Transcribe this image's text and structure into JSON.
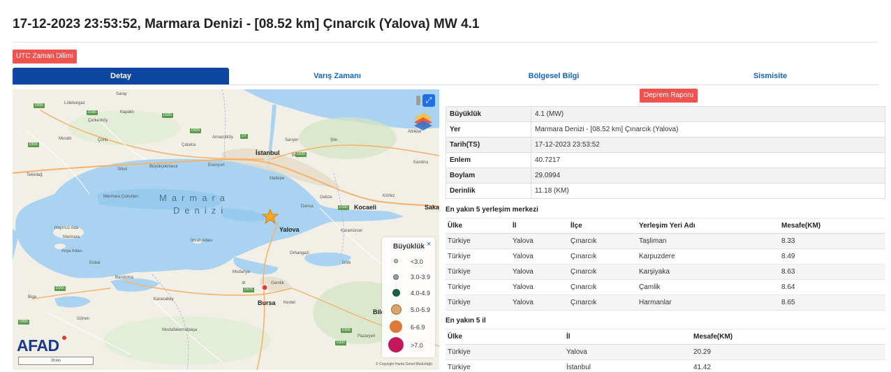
{
  "title": "17-12-2023 23:53:52, Marmara Denizi - [08.52 km] Çınarcık (Yalova) MW 4.1",
  "utc_button": "UTC Zaman Dilimi",
  "tabs": [
    {
      "label": "Detay",
      "active": true
    },
    {
      "label": "Varış Zamanı",
      "active": false
    },
    {
      "label": "Bölgesel Bilgi",
      "active": false
    },
    {
      "label": "Sismisite",
      "active": false
    }
  ],
  "report_button": "Deprem Raporu",
  "details": [
    {
      "key": "Büyüklük",
      "value": "4.1 (MW)"
    },
    {
      "key": "Yer",
      "value": "Marmara Denizi - [08.52 km] Çınarcık (Yalova)"
    },
    {
      "key": "Tarih(TS)",
      "value": "17-12-2023 23:53:52"
    },
    {
      "key": "Enlem",
      "value": "40.7217"
    },
    {
      "key": "Boylam",
      "value": "29.0994"
    },
    {
      "key": "Derinlik",
      "value": "11.18 (KM)"
    }
  ],
  "nearest_settlements": {
    "title": "En yakın 5 yerleşim merkezi",
    "columns": [
      "Ülke",
      "İl",
      "İlçe",
      "Yerleşim Yeri Adı",
      "Mesafe(KM)"
    ],
    "rows": [
      [
        "Türkiye",
        "Yalova",
        "Çınarcık",
        "Taşliman",
        "8.33"
      ],
      [
        "Türkiye",
        "Yalova",
        "Çınarcık",
        "Karpuzdere",
        "8.49"
      ],
      [
        "Türkiye",
        "Yalova",
        "Çınarcık",
        "Karşiyaka",
        "8.63"
      ],
      [
        "Türkiye",
        "Yalova",
        "Çınarcık",
        "Çamlik",
        "8.64"
      ],
      [
        "Türkiye",
        "Yalova",
        "Çınarcık",
        "Harmanlar",
        "8.65"
      ]
    ]
  },
  "nearest_provinces": {
    "title": "En yakın 5 il",
    "columns": [
      "Ülke",
      "İl",
      "Mesafe(KM)"
    ],
    "rows": [
      [
        "Türkiye",
        "Yalova",
        "20.29"
      ],
      [
        "Türkiye",
        "İstanbul",
        "41.42"
      ]
    ]
  },
  "map": {
    "sea_label_1": "Marmara",
    "sea_label_2": "Denizi",
    "cities": {
      "istanbul": "İstanbul",
      "yalova": "Yalova",
      "kocaeli": "Kocaeli",
      "bursa": "Bursa",
      "saka": "Saka",
      "bile": "Bile"
    },
    "places": [
      "Saray",
      "Lüleburgaz",
      "Kapaklı",
      "Çerkezköy",
      "Muratlı",
      "Çorlu",
      "Çatalca",
      "Arnavutköy",
      "Sarıyer",
      "Esenyurt",
      "Maltepe",
      "Darıca",
      "Gebze",
      "Körfez",
      "Marmara Çukurları",
      "Hayırsız Ada",
      "Marmara",
      "Avşa Adası",
      "Erdek",
      "Bandırma",
      "Mudanya",
      "Gemlik",
      "Orhangazi",
      "İznik",
      "Karacabey",
      "Mustafakemalpaşa",
      "Gönen",
      "Biga",
      "Kocaeli",
      "Karamürsel",
      "İmralı Adası",
      "Kandıra",
      "Şile",
      "Beykoz",
      "Pazaryeri",
      "Kestel",
      "Tekirdağ",
      "Büyükçekmece",
      "Silivri"
    ],
    "layers_label": "Altlıklar",
    "legend": {
      "title": "Büyüklük",
      "close": "×",
      "items": [
        {
          "label": "<3.0",
          "color": "#a5d6a7"
        },
        {
          "label": "3.0-3.9",
          "color": "#90a4ae"
        },
        {
          "label": "4.0-4.9",
          "color": "#1b5e4a"
        },
        {
          "label": "5.0-5.9",
          "color": "#d8a468"
        },
        {
          "label": "6-6.9",
          "color": "#e0773a"
        },
        {
          "label": ">7.0",
          "color": "#c2185b"
        }
      ]
    },
    "logo_text": "AFAD",
    "copyright": "© Copyright Harita Genel Müdürlüğü",
    "epicenter_color": "#f5a623"
  },
  "colors": {
    "accent": "#0d47a1",
    "danger": "#ef5350",
    "link": "#1565c0"
  }
}
